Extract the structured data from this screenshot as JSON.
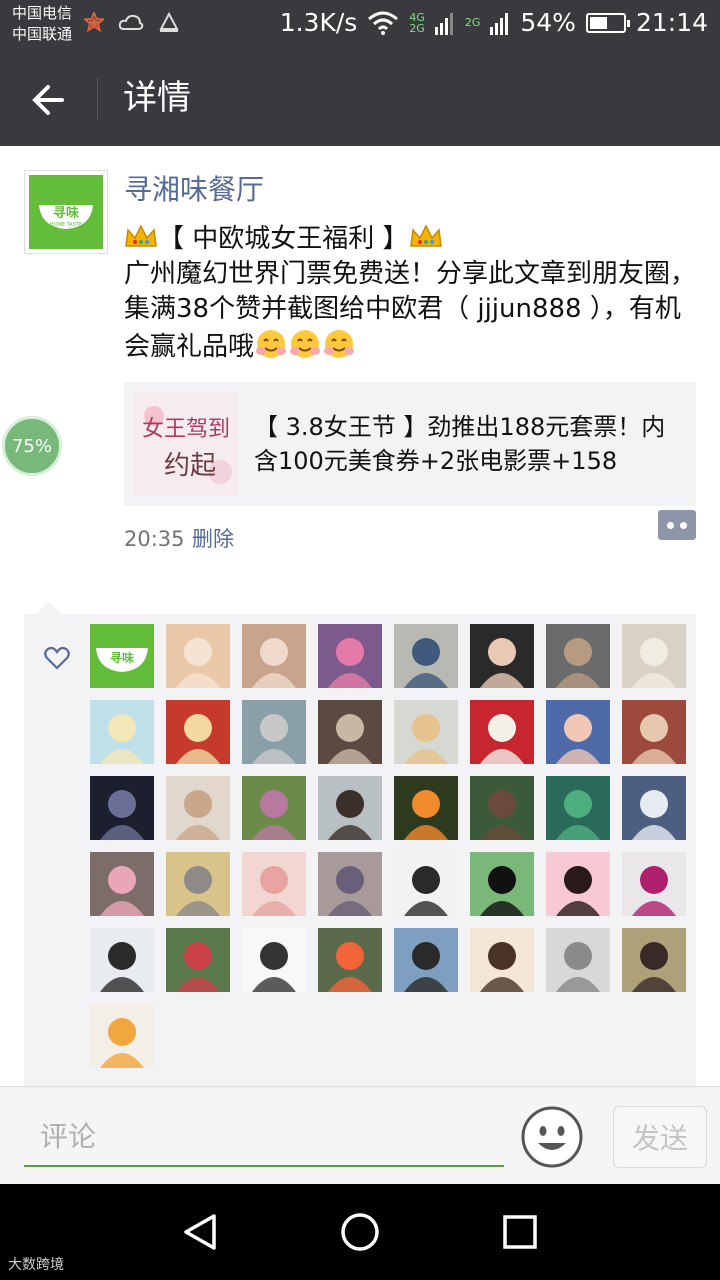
{
  "status_bar": {
    "carrier_1": "中国电信",
    "carrier_2": "中国联通",
    "speed": "1.3K/s",
    "network_4g": "4G",
    "network_2g_a": "2G",
    "network_2g_b": "2G",
    "battery": "54%",
    "battery_level": 0.54,
    "time": "21:14"
  },
  "header": {
    "title": "详情",
    "back_icon": "arrow-left-icon"
  },
  "post": {
    "author": "寻湘味餐厅",
    "avatar_text": "寻味",
    "avatar_subtext": "HOME TASTE",
    "text_headline": "【 中欧城女王福利 】",
    "text_body": "广州魔幻世界门票免费送！分享此文章到朋友圈，集满38个赞并截图给中欧君（ jjjun888 ），有机会赢礼品哦",
    "link_card": {
      "title": "【 3.8女王节 】劲推出188元套票！内含100元美食券+2张电影票+158",
      "thumb_text_line1": "女王驾到",
      "thumb_text_line2": "约起"
    },
    "time": "20:35",
    "delete_label": "删除"
  },
  "floating_badge": "75%",
  "likes": {
    "count": 41
  },
  "comment_bar": {
    "placeholder": "评论",
    "send_label": "发送"
  },
  "watermark": "大数跨境",
  "colors": {
    "titlebar": "#393a3f",
    "link_blue": "#576b95",
    "wechat_green": "#63bd3b",
    "panel_gray": "#f3f3f5"
  }
}
